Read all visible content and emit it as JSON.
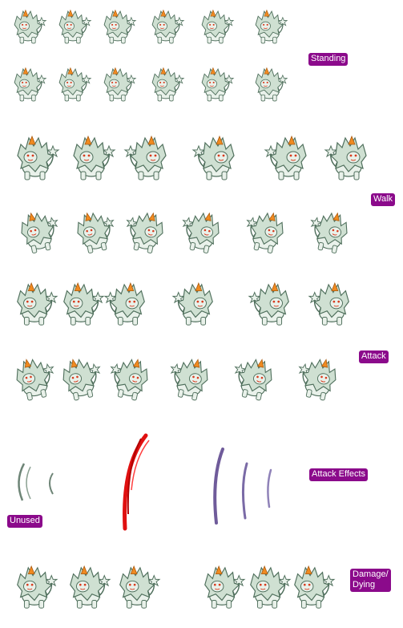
{
  "palette": {
    "body": "#e9f1ea",
    "mane": "#cfe0d2",
    "outline": "#4f6f5c",
    "horn": "#f08a20",
    "eye": "#d83b1d",
    "label_bg": "#8b0a8b",
    "label_text": "#ffffff",
    "slash_red": "#e01010",
    "slash_purple": "#6f5b9a",
    "slash_gray": "#6e8577"
  },
  "sections": [
    {
      "id": "standing",
      "label": "Standing"
    },
    {
      "id": "walk",
      "label": "Walk"
    },
    {
      "id": "attack",
      "label": "Attack"
    },
    {
      "id": "attack_effects",
      "label": "Attack Effects"
    },
    {
      "id": "unused",
      "label": "Unused"
    },
    {
      "id": "damage_dying",
      "label_lines": [
        "Damage/",
        "Dying"
      ]
    }
  ],
  "sprite_rows": [
    {
      "section": "standing",
      "frames": 6,
      "pose": "sit-front"
    },
    {
      "section": "standing",
      "frames": 6,
      "pose": "sit-side"
    },
    {
      "section": "walk",
      "frames": 6,
      "pose": "walk-a"
    },
    {
      "section": "walk",
      "frames": 6,
      "pose": "walk-b"
    },
    {
      "section": "attack",
      "frames": 6,
      "pose": "attack-a"
    },
    {
      "section": "attack",
      "frames": 6,
      "pose": "attack-b"
    },
    {
      "section": "damage_dying",
      "frames": 6,
      "pose": "damage"
    }
  ],
  "effects": [
    {
      "name": "gray-claw-slash",
      "color": "gray"
    },
    {
      "name": "red-claw-slash",
      "color": "red"
    },
    {
      "name": "purple-claw-slash",
      "color": "purple"
    }
  ]
}
